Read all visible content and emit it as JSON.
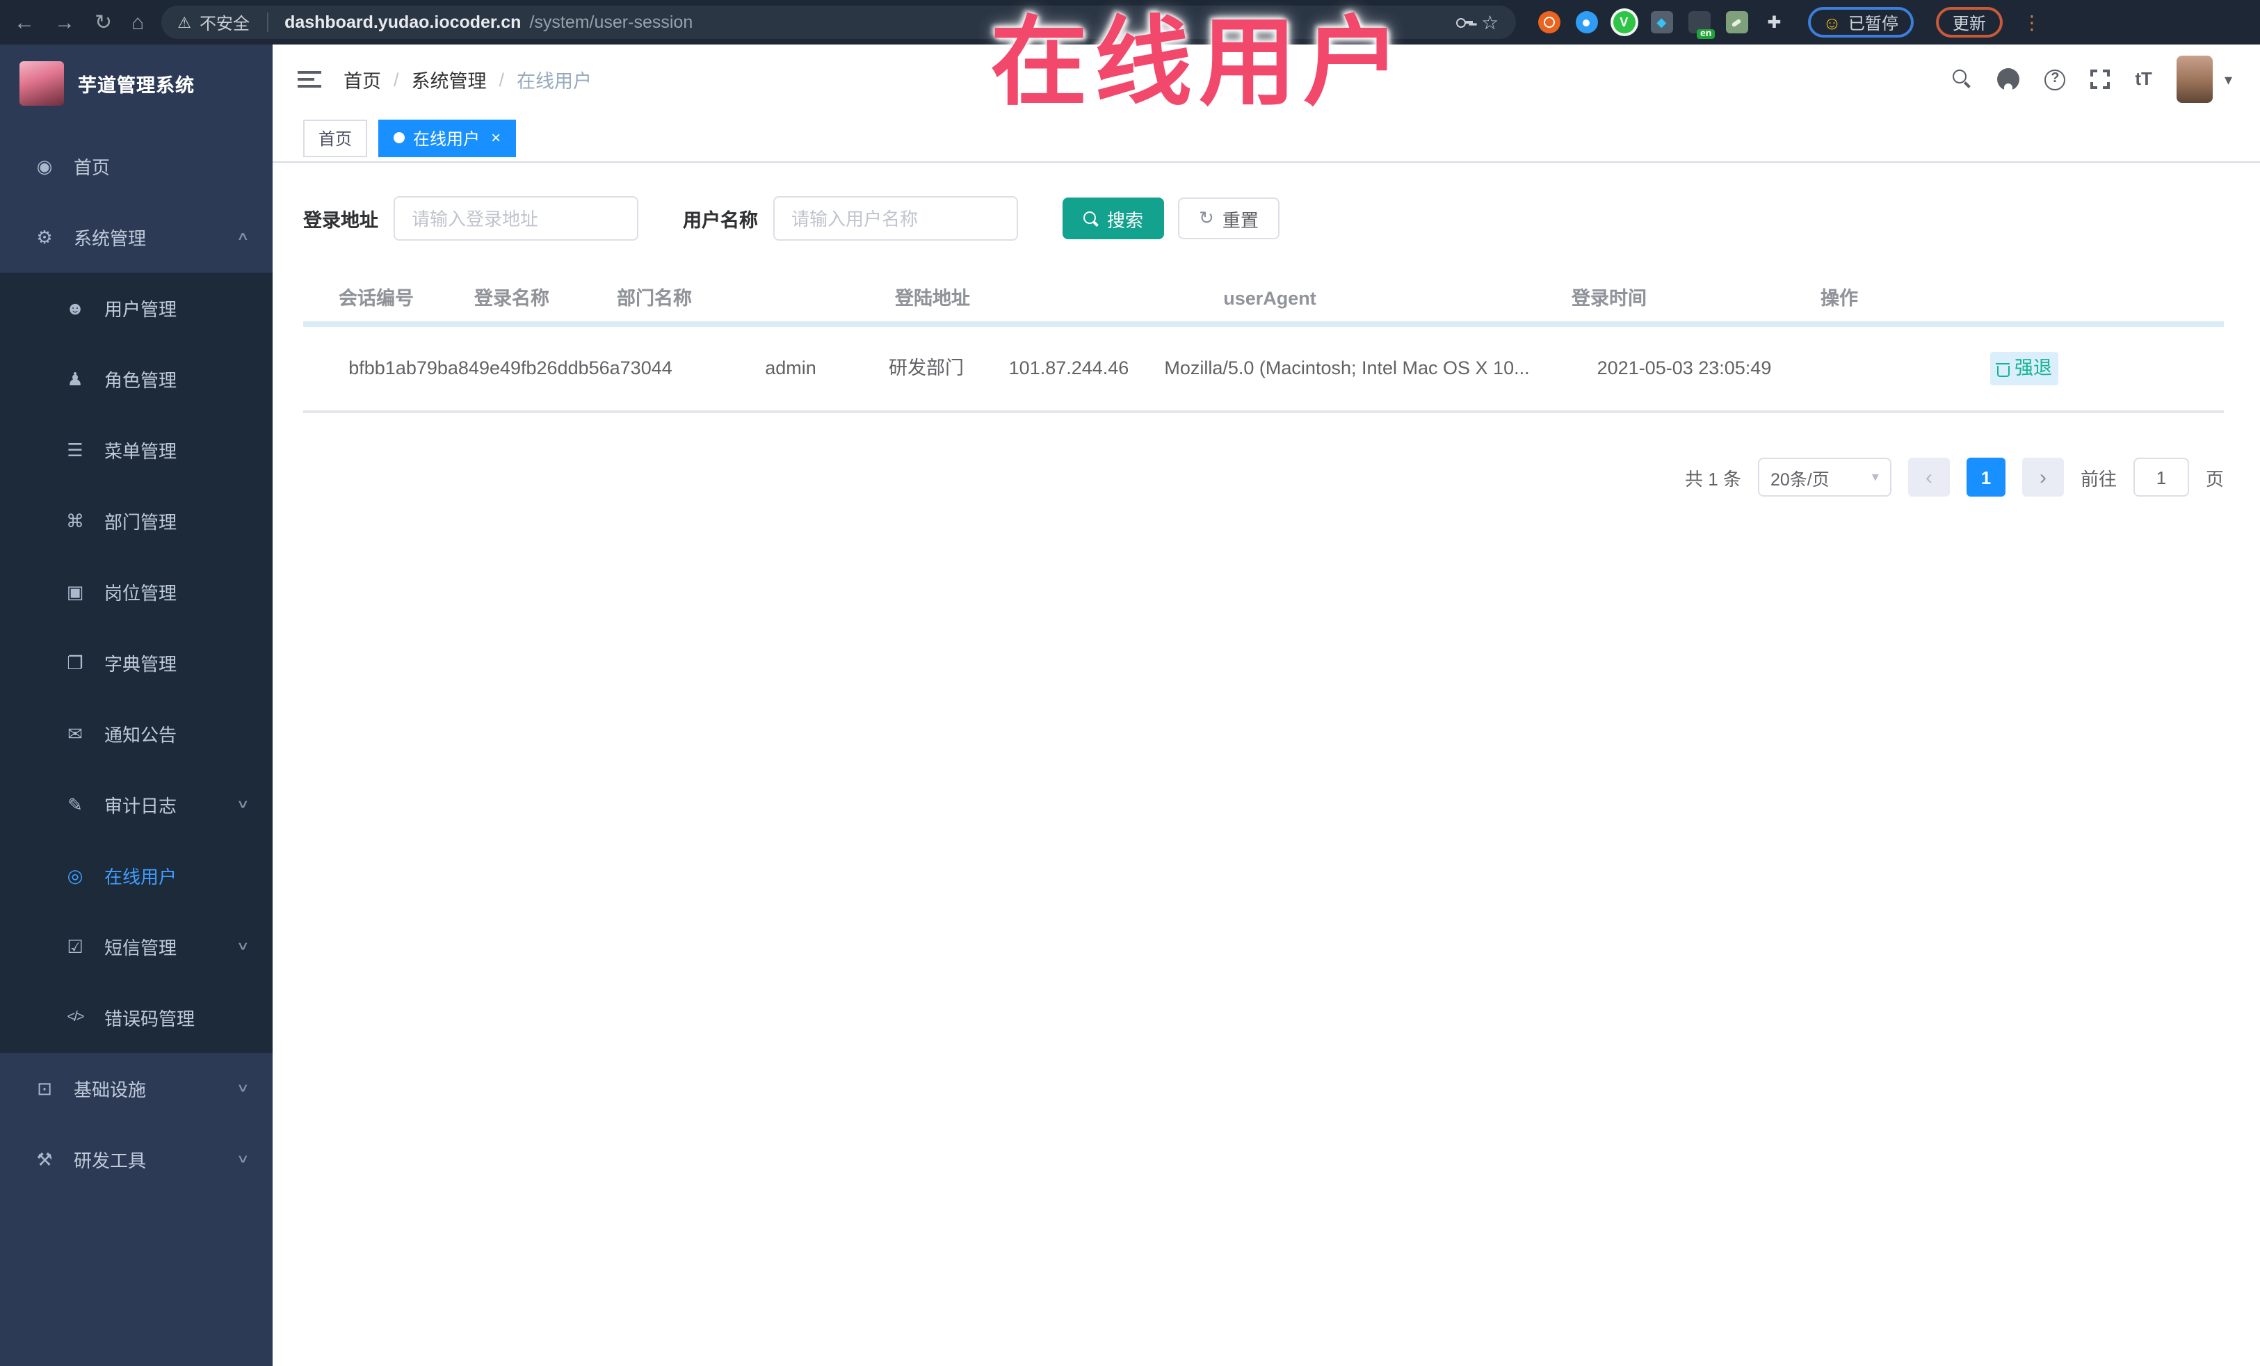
{
  "colors": {
    "accent": "#1890ff",
    "search_button": "#13a28d",
    "active_menu_link": "#409eff",
    "annotation": "#f1486b",
    "sidebar_bg": "#2d3a56",
    "submenu_bg": "#1c2a3a"
  },
  "annotation": {
    "text": "在线用户"
  },
  "browser": {
    "nav_icons": [
      "back-icon",
      "forward-icon",
      "reload-icon",
      "home-icon"
    ],
    "security_label": "不安全",
    "url_host": "dashboard.yudao.iocoder.cn",
    "url_path": "/system/user-session",
    "extensions": [
      "ubuntu-ext-icon",
      "pin-ext-icon",
      "vpn-ext-icon",
      "gem-ext-icon",
      "translate-ext-icon",
      "wallet-ext-icon",
      "extensions-puzzle-icon"
    ],
    "translate_badge": "en",
    "paused_badge": "已暂停",
    "update_button": "更新"
  },
  "sidebar": {
    "app_title": "芋道管理系统",
    "items": [
      {
        "label": "首页",
        "icon": "dashboard-icon"
      },
      {
        "label": "系统管理",
        "icon": "gear-icon",
        "chevron": "chevron-up-icon"
      },
      {
        "label": "用户管理",
        "icon": "user-icon",
        "sub": true
      },
      {
        "label": "角色管理",
        "icon": "roles-icon",
        "sub": true
      },
      {
        "label": "菜单管理",
        "icon": "menu-icon",
        "sub": true
      },
      {
        "label": "部门管理",
        "icon": "dept-icon",
        "sub": true
      },
      {
        "label": "岗位管理",
        "icon": "post-icon",
        "sub": true
      },
      {
        "label": "字典管理",
        "icon": "dict-icon",
        "sub": true
      },
      {
        "label": "通知公告",
        "icon": "notice-icon",
        "sub": true
      },
      {
        "label": "审计日志",
        "icon": "audit-icon",
        "sub": true,
        "chevron": "chevron-down-icon"
      },
      {
        "label": "在线用户",
        "icon": "online-icon",
        "sub": true,
        "active": true
      },
      {
        "label": "短信管理",
        "icon": "sms-icon",
        "sub": true,
        "chevron": "chevron-down-icon"
      },
      {
        "label": "错误码管理",
        "icon": "code-icon",
        "sub": true
      },
      {
        "label": "基础设施",
        "icon": "infra-icon",
        "chevron": "chevron-down-icon"
      },
      {
        "label": "研发工具",
        "icon": "tools-icon",
        "chevron": "chevron-down-icon"
      }
    ]
  },
  "navbar": {
    "breadcrumb": [
      "首页",
      "系统管理",
      "在线用户"
    ],
    "breadcrumb_separator": "/",
    "action_icons": [
      "search-icon",
      "github-icon",
      "help-icon",
      "fullscreen-icon",
      "textsize-icon"
    ]
  },
  "tabs": [
    {
      "label": "首页",
      "active": false
    },
    {
      "label": "在线用户",
      "active": true,
      "close": "close-icon"
    }
  ],
  "filters": {
    "login_address_label": "登录地址",
    "login_address_placeholder": "请输入登录地址",
    "username_label": "用户名称",
    "username_placeholder": "请输入用户名称",
    "search_label": "搜索",
    "reset_label": "重置"
  },
  "table": {
    "columns": [
      "会话编号",
      "登录名称",
      "部门名称",
      "登陆地址",
      "userAgent",
      "登录时间",
      "操作"
    ],
    "rows": [
      {
        "session_id": "bfbb1ab79ba849e49fb26ddb56a73044",
        "login_name": "admin",
        "dept_name": "研发部门",
        "login_address": "101.87.244.46",
        "user_agent": "Mozilla/5.0 (Macintosh; Intel Mac OS X 10...",
        "login_time": "2021-05-03 23:05:49",
        "action_label": "强退",
        "action_icon": "trash-icon"
      }
    ]
  },
  "pagination": {
    "total_label": "共 1 条",
    "page_size": "20条/页",
    "current_page": "1",
    "goto_label": "前往",
    "goto_value": "1",
    "page_suffix": "页"
  }
}
